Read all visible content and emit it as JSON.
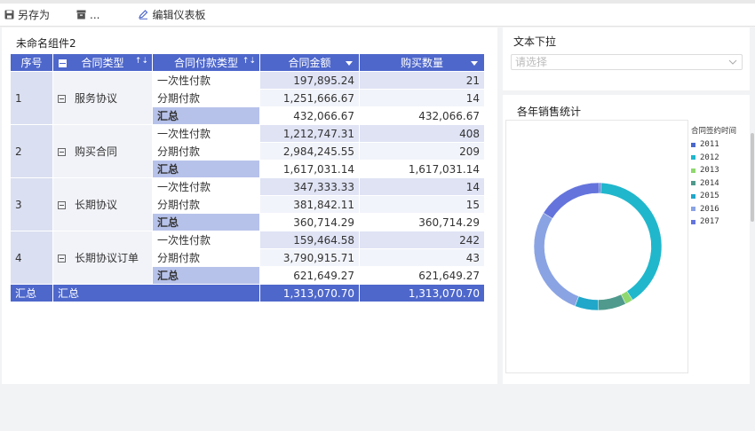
{
  "toolbar": {
    "save_as": "另存为",
    "more": "...",
    "edit_dashboard": "编辑仪表板"
  },
  "table_widget": {
    "title": "未命名组件2",
    "headers": {
      "seq": "序号",
      "type": "合同类型",
      "pay": "合同付款类型",
      "amount": "合同金额",
      "qty": "购买数量"
    },
    "groups": [
      {
        "seq": "1",
        "type": "服务协议",
        "rows": [
          {
            "pay": "一次性付款",
            "amount": "197,895.24",
            "qty": "21"
          },
          {
            "pay": "分期付款",
            "amount": "1,251,666.67",
            "qty": "14"
          },
          {
            "pay": "汇总",
            "amount": "432,066.67",
            "qty": "432,066.67"
          }
        ]
      },
      {
        "seq": "2",
        "type": "购买合同",
        "rows": [
          {
            "pay": "一次性付款",
            "amount": "1,212,747.31",
            "qty": "408"
          },
          {
            "pay": "分期付款",
            "amount": "2,984,245.55",
            "qty": "209"
          },
          {
            "pay": "汇总",
            "amount": "1,617,031.14",
            "qty": "1,617,031.14"
          }
        ]
      },
      {
        "seq": "3",
        "type": "长期协议",
        "rows": [
          {
            "pay": "一次性付款",
            "amount": "347,333.33",
            "qty": "14"
          },
          {
            "pay": "分期付款",
            "amount": "381,842.11",
            "qty": "15"
          },
          {
            "pay": "汇总",
            "amount": "360,714.29",
            "qty": "360,714.29"
          }
        ]
      },
      {
        "seq": "4",
        "type": "长期协议订单",
        "rows": [
          {
            "pay": "一次性付款",
            "amount": "159,464.58",
            "qty": "242"
          },
          {
            "pay": "分期付款",
            "amount": "3,790,915.71",
            "qty": "43"
          },
          {
            "pay": "汇总",
            "amount": "621,649.27",
            "qty": "621,649.27"
          }
        ]
      }
    ],
    "total": {
      "seq": "汇总",
      "type": "汇总",
      "amount": "1,313,070.70",
      "qty": "1,313,070.70"
    }
  },
  "dropdown_widget": {
    "title": "文本下拉",
    "placeholder": "请选择"
  },
  "chart_widget": {
    "title": "各年销售统计"
  },
  "chart_data": {
    "type": "pie",
    "legend_title": "合同签约时间",
    "legend_placement": "right",
    "series": [
      {
        "name": "2011",
        "value": 0.5,
        "color": "#4a68c9"
      },
      {
        "name": "2012",
        "value": 40,
        "color": "#20b7cc"
      },
      {
        "name": "2013",
        "value": 2,
        "color": "#8fd86f"
      },
      {
        "name": "2014",
        "value": 7,
        "color": "#4f9a8d"
      },
      {
        "name": "2015",
        "value": 6,
        "color": "#20a7c9"
      },
      {
        "name": "2016",
        "value": 28,
        "color": "#8aa3e3"
      },
      {
        "name": "2017",
        "value": 16.5,
        "color": "#6474dc"
      }
    ]
  }
}
